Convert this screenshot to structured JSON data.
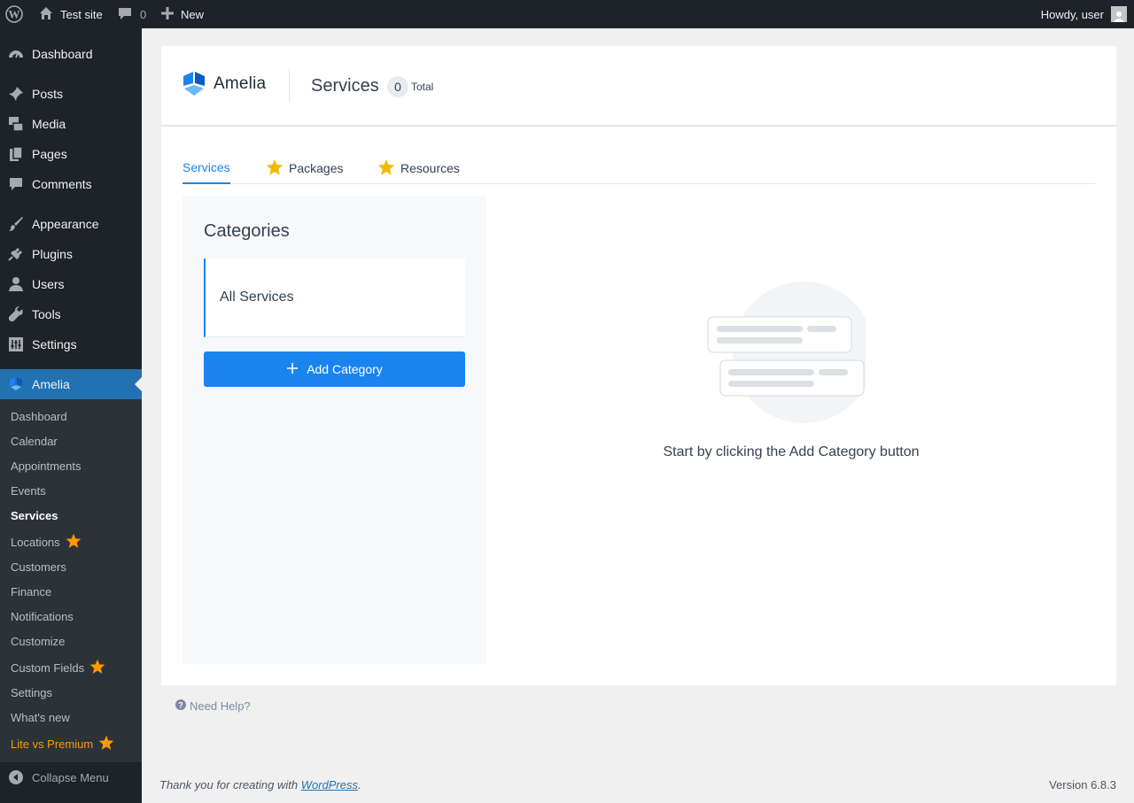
{
  "adminbar": {
    "site_name": "Test site",
    "comments_count": "0",
    "new_label": "New",
    "howdy": "Howdy, user"
  },
  "sidebar": {
    "items": [
      {
        "label": "Dashboard",
        "icon": "dashboard-icon"
      },
      {
        "label": "Posts",
        "icon": "pushpin-icon"
      },
      {
        "label": "Media",
        "icon": "media-icon"
      },
      {
        "label": "Pages",
        "icon": "pages-icon"
      },
      {
        "label": "Comments",
        "icon": "comment-icon"
      },
      {
        "label": "Appearance",
        "icon": "paintbrush-icon"
      },
      {
        "label": "Plugins",
        "icon": "plugin-icon"
      },
      {
        "label": "Users",
        "icon": "user-icon"
      },
      {
        "label": "Tools",
        "icon": "wrench-icon"
      },
      {
        "label": "Settings",
        "icon": "settings-icon"
      },
      {
        "label": "Amelia",
        "icon": "amelia-icon"
      }
    ],
    "submenu": [
      "Dashboard",
      "Calendar",
      "Appointments",
      "Events",
      "Services",
      "Locations",
      "Customers",
      "Finance",
      "Notifications",
      "Customize",
      "Custom Fields",
      "Settings",
      "What's new",
      "Lite vs Premium"
    ],
    "collapse_label": "Collapse Menu"
  },
  "header": {
    "logo_text": "Amelia",
    "title": "Services",
    "count": "0",
    "count_label": "Total"
  },
  "tabs": [
    {
      "label": "Services",
      "premium": false
    },
    {
      "label": "Packages",
      "premium": true
    },
    {
      "label": "Resources",
      "premium": true
    }
  ],
  "categories": {
    "title": "Categories",
    "all_label": "All Services",
    "add_button": "Add Category"
  },
  "empty_state": {
    "message": "Start by clicking the Add Category button"
  },
  "footer": {
    "need_help": "Need Help?",
    "thanks_prefix": "Thank you for creating with ",
    "wordpress_link": "WordPress",
    "thanks_suffix": ".",
    "version": "Version 6.8.3"
  },
  "colors": {
    "accent": "#1a84ee",
    "wp_blue": "#2271b1",
    "premium_star": "#ff9900",
    "admin_dark": "#1d2327"
  }
}
